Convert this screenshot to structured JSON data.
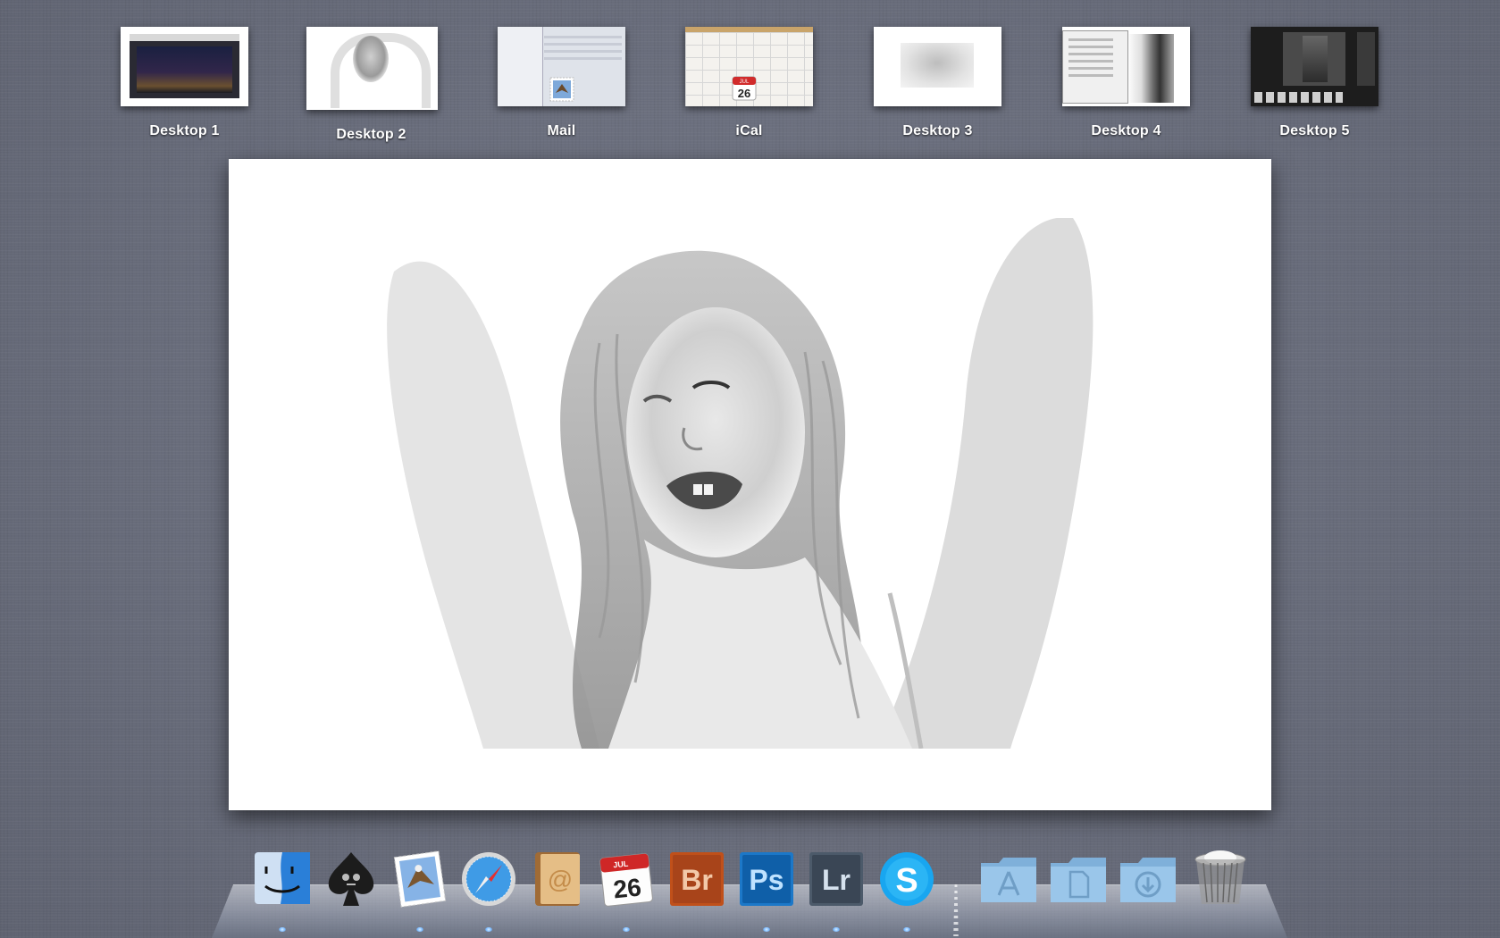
{
  "spaces": [
    {
      "label": "Desktop 1"
    },
    {
      "label": "Desktop 2"
    },
    {
      "label": "Mail"
    },
    {
      "label": "iCal"
    },
    {
      "label": "Desktop 3"
    },
    {
      "label": "Desktop 4"
    },
    {
      "label": "Desktop 5"
    }
  ],
  "ical_badge": {
    "month": "JUL",
    "day": "26"
  },
  "dock": {
    "items": [
      {
        "name": "Finder",
        "icon": "finder-icon"
      },
      {
        "name": "Ace of Spades app",
        "icon": "spade-skull-icon"
      },
      {
        "name": "Mail",
        "icon": "mail-stamp-icon"
      },
      {
        "name": "Safari",
        "icon": "compass-icon"
      },
      {
        "name": "Address Book",
        "icon": "address-book-icon"
      },
      {
        "name": "iCal",
        "icon": "calendar-icon"
      },
      {
        "name": "Adobe Bridge",
        "icon": "bridge-icon",
        "text": "Br"
      },
      {
        "name": "Adobe Photoshop",
        "icon": "photoshop-icon",
        "text": "Ps"
      },
      {
        "name": "Adobe Lightroom",
        "icon": "lightroom-icon",
        "text": "Lr"
      },
      {
        "name": "Skype",
        "icon": "skype-icon",
        "text": "S"
      },
      {
        "name": "Applications",
        "icon": "applications-folder-icon"
      },
      {
        "name": "Documents",
        "icon": "documents-folder-icon"
      },
      {
        "name": "Downloads",
        "icon": "downloads-folder-icon"
      },
      {
        "name": "Trash",
        "icon": "trash-icon"
      }
    ],
    "calendar": {
      "month": "JUL",
      "day": "26"
    }
  },
  "colors": {
    "background": "#6b6f7d",
    "bridge": "#c0501a",
    "photoshop": "#1c78c8",
    "lightroom": "#4c5a6a",
    "skype": "#18a6f0",
    "folder": "#8fbbe0"
  }
}
